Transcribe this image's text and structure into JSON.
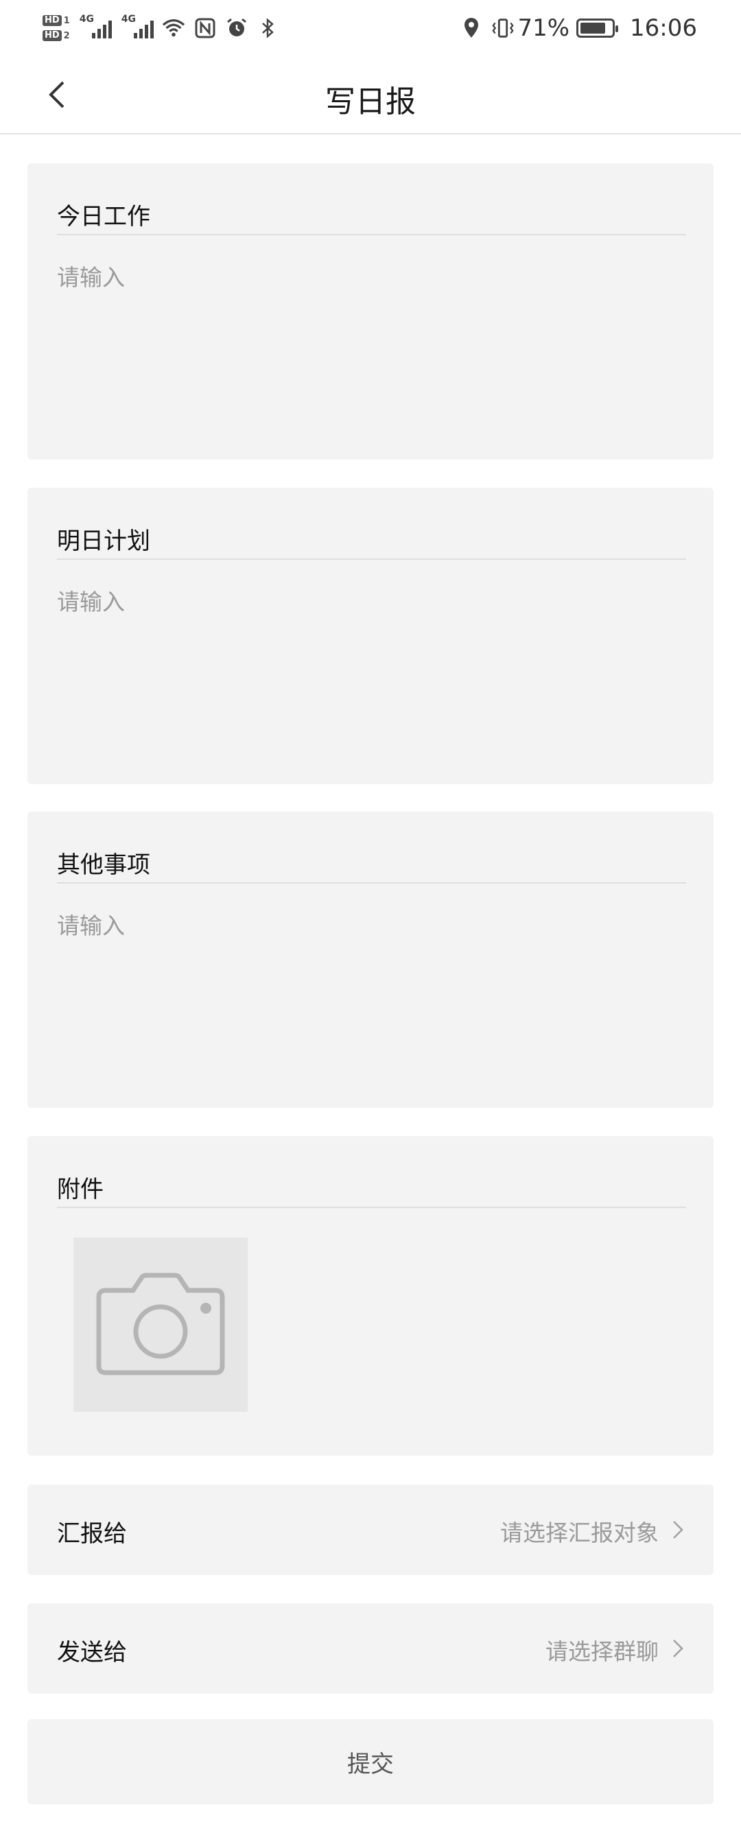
{
  "status_bar": {
    "hd1": "HD",
    "hd1_num": "1",
    "hd2": "HD",
    "hd2_num": "2",
    "net1": "4G",
    "net2": "4G",
    "battery": "71%",
    "time": "16:06",
    "icons": [
      "wifi-icon",
      "nfc-icon",
      "alarm-icon",
      "bluetooth-icon",
      "location-icon",
      "vibrate-icon",
      "battery-icon"
    ]
  },
  "nav": {
    "title": "写日报",
    "back_icon": "chevron-left-icon"
  },
  "sections": [
    {
      "title": "今日工作",
      "placeholder": "请输入"
    },
    {
      "title": "明日计划",
      "placeholder": "请输入"
    },
    {
      "title": "其他事项",
      "placeholder": "请输入"
    }
  ],
  "attachment": {
    "title": "附件",
    "icon": "camera-icon"
  },
  "report_to": {
    "label": "汇报给",
    "value": "请选择汇报对象"
  },
  "send_to": {
    "label": "发送给",
    "value": "请选择群聊"
  },
  "submit": {
    "label": "提交"
  },
  "colors": {
    "card_bg": "#f3f3f3",
    "placeholder": "#9a9a9a",
    "divider": "#dedede"
  }
}
